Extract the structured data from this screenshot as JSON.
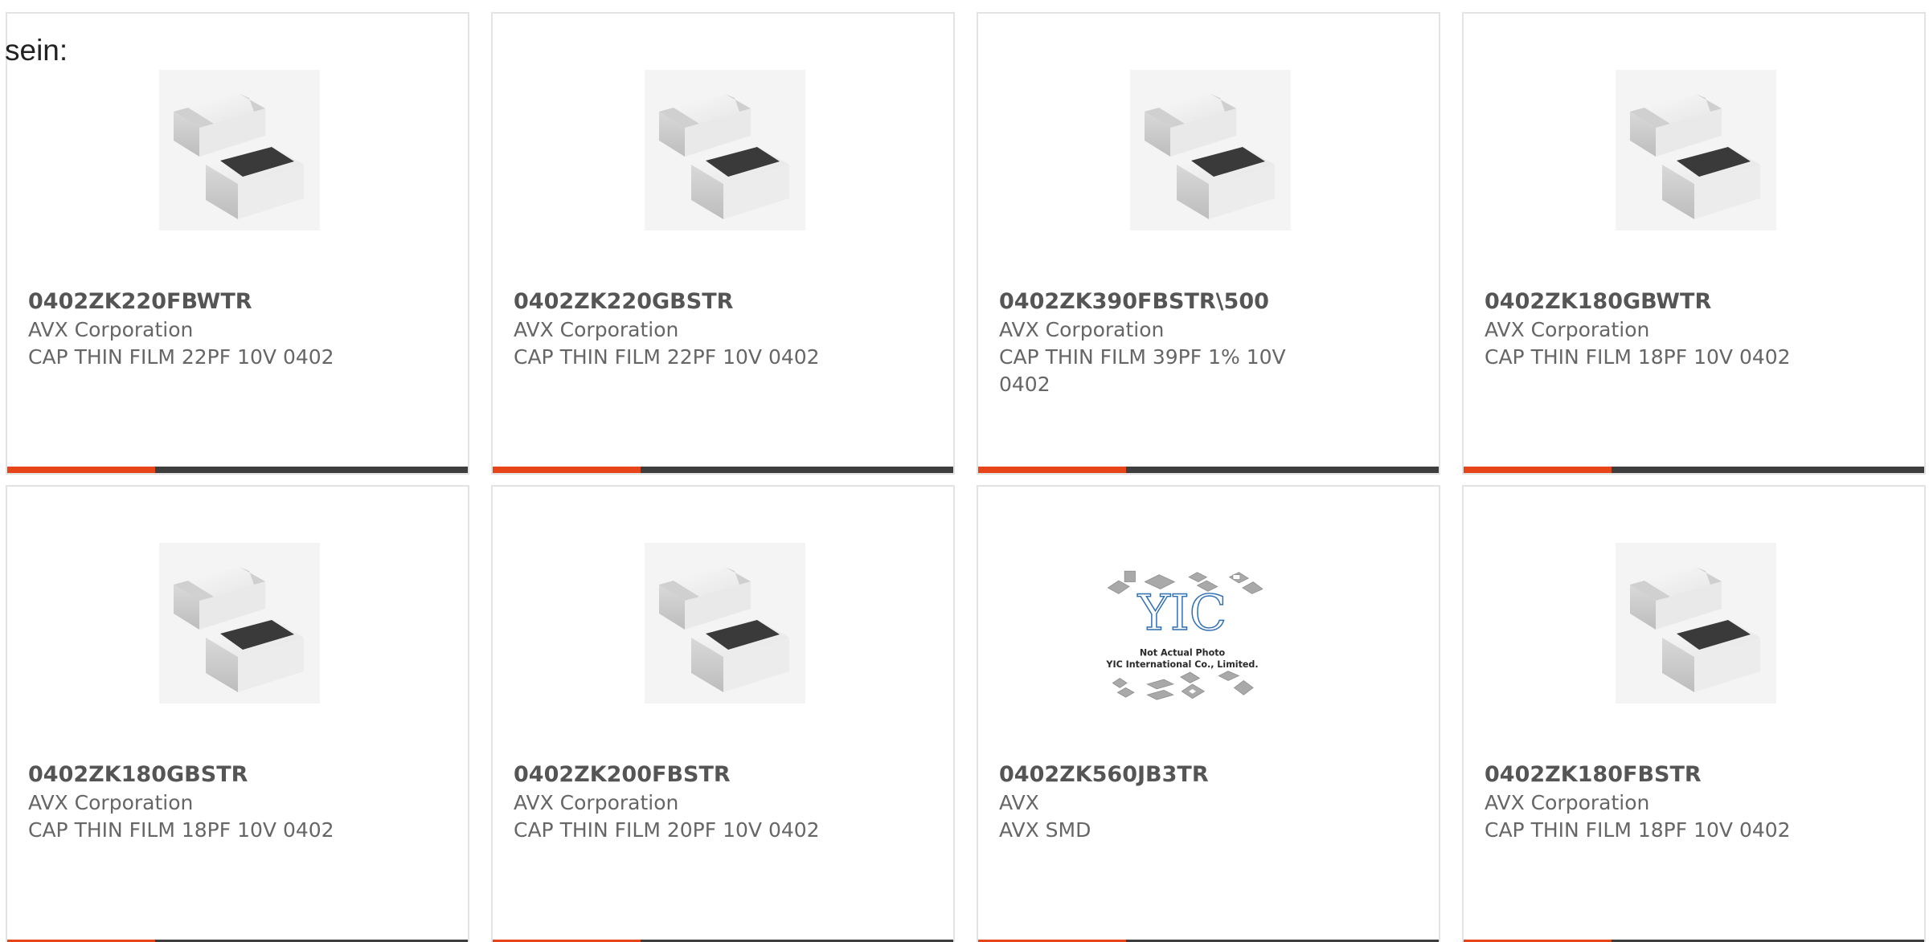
{
  "overflow_text": "sein:",
  "colors": {
    "accent": "#e8441a",
    "bar": "#3e3e3e",
    "border": "#e3e3e3",
    "title": "#555555",
    "text": "#666666"
  },
  "products": [
    {
      "part_no": "0402ZK220FBWTR",
      "manufacturer": "AVX Corporation",
      "description": "CAP THIN FILM 22PF 10V 0402",
      "image": "chip-capacitor-image"
    },
    {
      "part_no": "0402ZK220GBSTR",
      "manufacturer": "AVX Corporation",
      "description": "CAP THIN FILM 22PF 10V 0402",
      "image": "chip-capacitor-image"
    },
    {
      "part_no": "0402ZK390FBSTR\\500",
      "manufacturer": "AVX Corporation",
      "description": "CAP THIN FILM 39PF 1% 10V 0402",
      "image": "chip-capacitor-image"
    },
    {
      "part_no": "0402ZK180GBWTR",
      "manufacturer": "AVX Corporation",
      "description": "CAP THIN FILM 18PF 10V 0402",
      "image": "chip-capacitor-image"
    },
    {
      "part_no": "0402ZK180GBSTR",
      "manufacturer": "AVX Corporation",
      "description": "CAP THIN FILM 18PF 10V 0402",
      "image": "chip-capacitor-image"
    },
    {
      "part_no": "0402ZK200FBSTR",
      "manufacturer": "AVX Corporation",
      "description": "CAP THIN FILM 20PF 10V 0402",
      "image": "chip-capacitor-image"
    },
    {
      "part_no": "0402ZK560JB3TR",
      "manufacturer": "AVX",
      "description": "AVX SMD",
      "image": "placeholder-image",
      "placeholder": {
        "logo": "YIC",
        "line1": "Not Actual Photo",
        "line2": "YIC International Co., Limited."
      }
    },
    {
      "part_no": "0402ZK180FBSTR",
      "manufacturer": "AVX Corporation",
      "description": "CAP THIN FILM 18PF 10V 0402",
      "image": "chip-capacitor-image"
    }
  ]
}
